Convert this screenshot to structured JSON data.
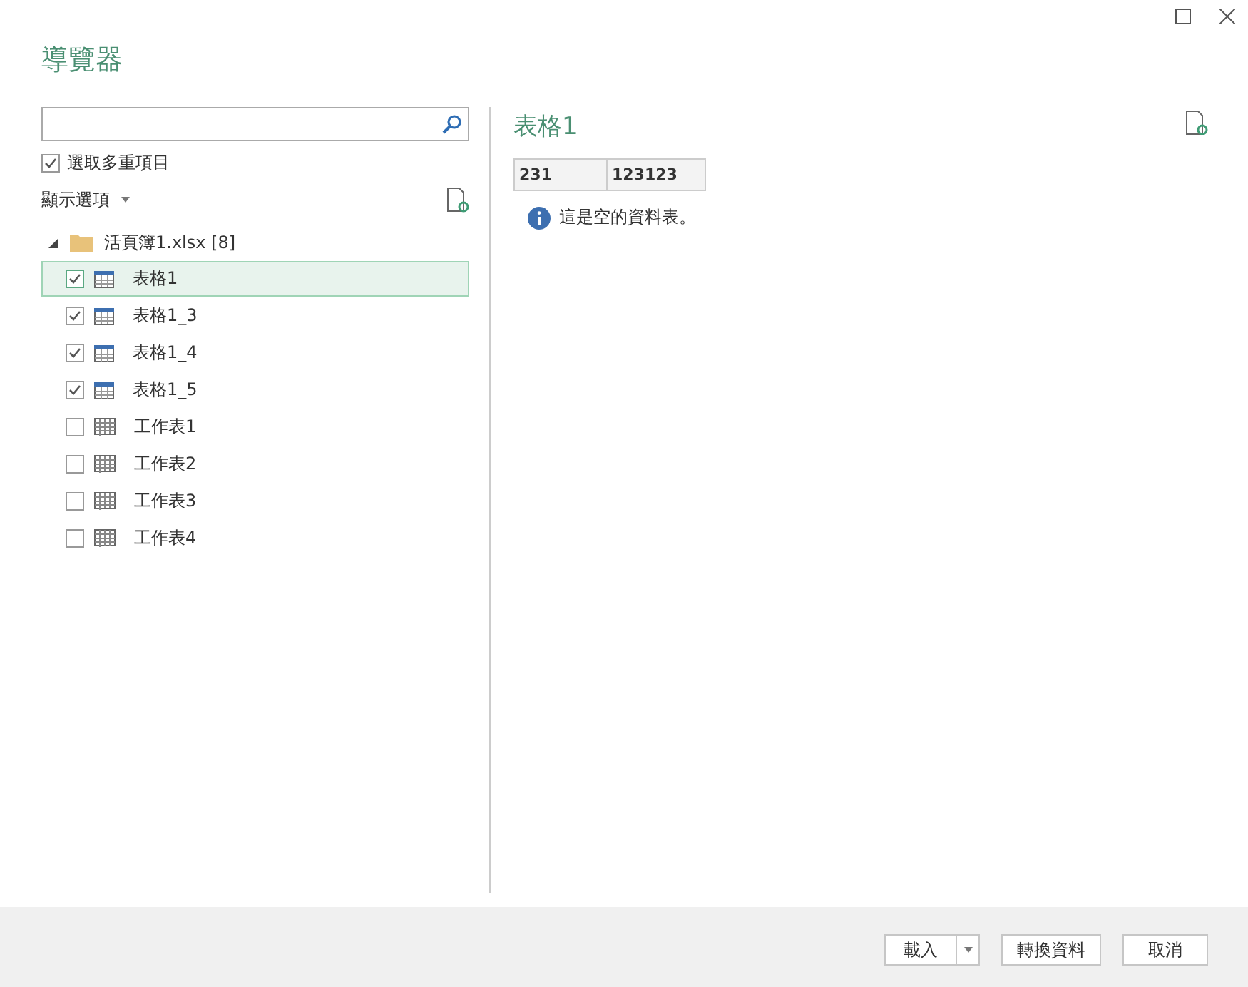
{
  "window": {
    "title": "導覽器"
  },
  "multi_select": {
    "label": "選取多重項目",
    "checked": true
  },
  "display_options": {
    "label": "顯示選項"
  },
  "tree": {
    "label": "活頁簿1.xlsx [8]",
    "expanded": true,
    "children": [
      {
        "label": "表格1",
        "kind": "table",
        "checked": true,
        "selected": true
      },
      {
        "label": "表格1_3",
        "kind": "table",
        "checked": true,
        "selected": false
      },
      {
        "label": "表格1_4",
        "kind": "table",
        "checked": true,
        "selected": false
      },
      {
        "label": "表格1_5",
        "kind": "table",
        "checked": true,
        "selected": false
      },
      {
        "label": "工作表1",
        "kind": "sheet",
        "checked": false,
        "selected": false
      },
      {
        "label": "工作表2",
        "kind": "sheet",
        "checked": false,
        "selected": false
      },
      {
        "label": "工作表3",
        "kind": "sheet",
        "checked": false,
        "selected": false
      },
      {
        "label": "工作表4",
        "kind": "sheet",
        "checked": false,
        "selected": false
      }
    ]
  },
  "preview": {
    "title": "表格1",
    "columns": [
      "231",
      "123123"
    ],
    "message": "這是空的資料表。"
  },
  "buttons": [
    {
      "label": "載入",
      "kind": "split"
    },
    {
      "label": "轉換資料",
      "kind": "plain"
    },
    {
      "label": "取消",
      "kind": "plain"
    }
  ]
}
